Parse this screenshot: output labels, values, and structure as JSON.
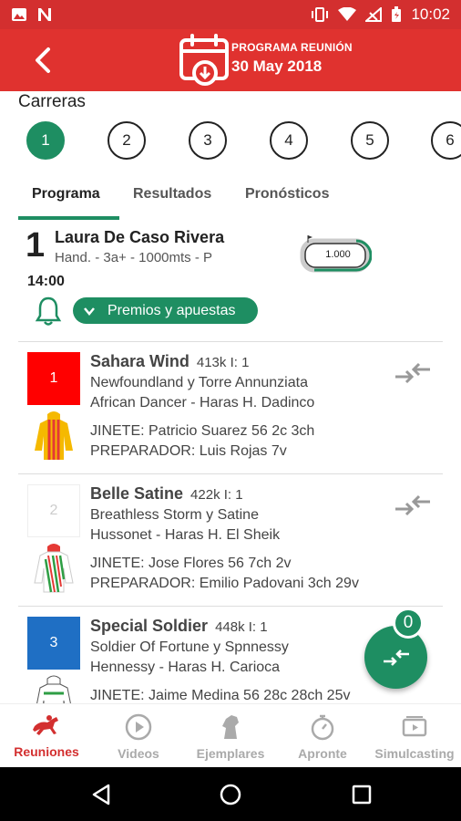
{
  "status_bar": {
    "time": "10:02"
  },
  "header": {
    "subtitle": "PROGRAMA REUNIÓN",
    "date": "30 May 2018"
  },
  "races_title": "Carreras",
  "races": [
    "1",
    "2",
    "3",
    "4",
    "5",
    "6"
  ],
  "active_race": "1",
  "tabs": [
    {
      "label": "Programa",
      "active": true
    },
    {
      "label": "Resultados",
      "active": false
    },
    {
      "label": "Pronósticos",
      "active": false
    }
  ],
  "race": {
    "number": "1",
    "name": "Laura De Caso Rivera",
    "details": "Hand. - 3a+ - 1000mts - P",
    "time": "14:00",
    "distance_label": "1.000",
    "premios_label": "Premios y apuestas"
  },
  "runners": [
    {
      "number": "1",
      "saddle_color": "#ff0000",
      "number_color": "#ffffff",
      "name": "Sahara Wind",
      "meta": "413k I: 1",
      "breeding": "Newfoundland y Torre Annunziata",
      "owner": " African Dancer - Haras H. Dadinco",
      "jockey": "JINETE: Patricio Suarez 56 2c 3ch",
      "trainer": "PREPARADOR: Luis Rojas 7v"
    },
    {
      "number": "2",
      "saddle_color": "#ffffff",
      "number_color": "#cccccc",
      "name": "Belle Satine",
      "meta": "422k I: 1",
      "breeding": "Breathless Storm y Satine",
      "owner": " Hussonet - Haras H. El Sheik",
      "jockey": "JINETE: Jose Flores 56 7ch 2v",
      "trainer": "PREPARADOR: Emilio Padovani 3ch 29v"
    },
    {
      "number": "3",
      "saddle_color": "#1f6fc4",
      "number_color": "#ffffff",
      "name": "Special Soldier",
      "meta": "448k I: 1",
      "breeding": "Soldier Of Fortune y Spnnessy",
      "owner": " Hennessy - Haras H. Carioca",
      "jockey": "JINETE: Jaime Medina 56 28c 28ch 25v",
      "trainer": ""
    }
  ],
  "fab": {
    "badge": "0"
  },
  "bottom_nav": [
    {
      "label": "Reuniones",
      "icon": "horse-racing-icon",
      "active": true
    },
    {
      "label": "Videos",
      "icon": "play-icon",
      "active": false
    },
    {
      "label": "Ejemplares",
      "icon": "horse-head-icon",
      "active": false
    },
    {
      "label": "Apronte",
      "icon": "stopwatch-icon",
      "active": false
    },
    {
      "label": "Simulcasting",
      "icon": "tv-play-icon",
      "active": false
    }
  ],
  "colors": {
    "brand_red": "#e0322f",
    "accent_green": "#1e8e62"
  }
}
